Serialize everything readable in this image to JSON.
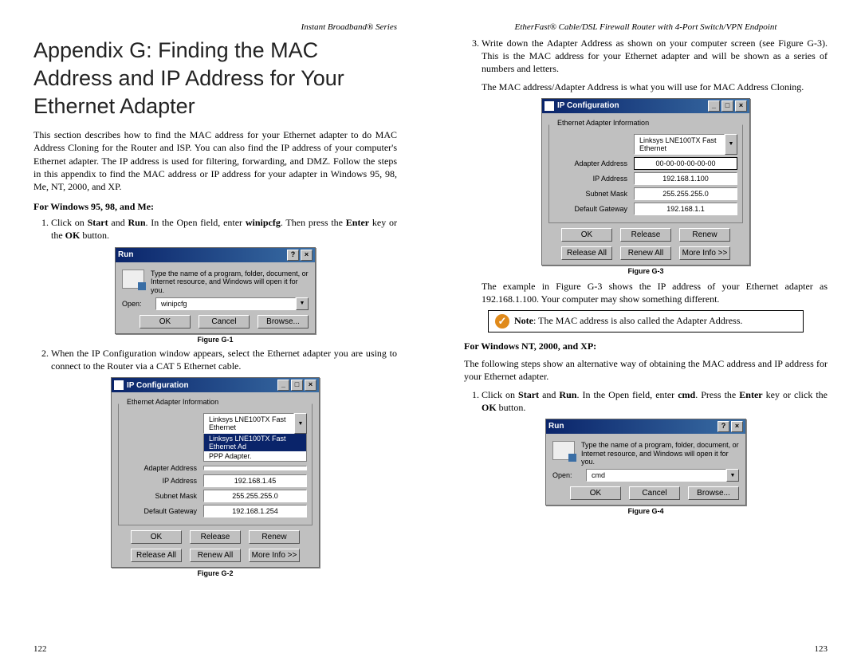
{
  "left": {
    "running_head": "Instant Broadband® Series",
    "title": "Appendix G: Finding the MAC Address and IP Address for Your Ethernet Adapter",
    "intro": "This section describes how to find the MAC address for your Ethernet adapter to do MAC Address Cloning for the Router and ISP. You can also find the IP address of your computer's Ethernet adapter. The IP address is used for filtering, forwarding, and DMZ. Follow the steps in this appendix to find the MAC address or IP address for your adapter in Windows 95, 98, Me, NT, 2000, and XP.",
    "subhead1": "For Windows 95, 98, and Me:",
    "step1_pre": "Click on ",
    "step1_b1": "Start",
    "step1_mid1": " and ",
    "step1_b2": "Run",
    "step1_mid2": ". In the Open field, enter ",
    "step1_b3": "winipcfg",
    "step1_mid3": ". Then press the ",
    "step1_b4": "Enter",
    "step1_mid4": " key or the ",
    "step1_b5": "OK",
    "step1_end": " button.",
    "figcap1": "Figure G-1",
    "step2": "When the IP Configuration window appears, select the Ethernet adapter you are using to connect to the Router via a CAT 5 Ethernet cable.",
    "figcap2": "Figure G-2",
    "pagenum": "122",
    "run_dialog": {
      "title": "Run",
      "hint": "Type the name of a program, folder, document, or Internet resource, and Windows will open it for you.",
      "open_label": "Open:",
      "open_value": "winipcfg",
      "ok": "OK",
      "cancel": "Cancel",
      "browse": "Browse..."
    },
    "ipcfg": {
      "title": "IP Configuration",
      "group": "Ethernet Adapter Information",
      "combo": "Linksys LNE100TX Fast Ethernet",
      "combo_sel": "Linksys LNE100TX Fast Ethernet Ad",
      "combo_opt2": "PPP Adapter.",
      "lab_adapter": "Adapter Address",
      "val_adapter": "",
      "lab_ip": "IP Address",
      "val_ip": "192.168.1.45",
      "lab_mask": "Subnet Mask",
      "val_mask": "255.255.255.0",
      "lab_gw": "Default Gateway",
      "val_gw": "192.168.1.254",
      "ok": "OK",
      "release": "Release",
      "renew": "Renew",
      "release_all": "Release All",
      "renew_all": "Renew All",
      "more": "More Info >>"
    }
  },
  "right": {
    "running_head": "EtherFast® Cable/DSL Firewall Router with 4-Port Switch/VPN Endpoint",
    "step3": "Write down the Adapter Address as shown on your computer screen (see Figure G-3). This is the MAC address for your Ethernet adapter and will be shown as a series of numbers and letters.",
    "clone": "The MAC address/Adapter Address is what you will use for MAC Address Cloning.",
    "figcap3": "Figure G-3",
    "example": "The example in Figure G-3 shows the IP address of your Ethernet adapter as 192.168.1.100. Your computer may show something different.",
    "note_b": "Note",
    "note_rest": ": The MAC address is also called the Adapter Address.",
    "subhead2": "For Windows NT, 2000, and XP:",
    "altsteps": "The following steps show an alternative way of obtaining the MAC address and IP address for your Ethernet adapter.",
    "step1r_pre": "Click on ",
    "step1r_b1": "Start",
    "step1r_mid1": " and ",
    "step1r_b2": "Run",
    "step1r_mid2": ". In the Open field, enter ",
    "step1r_b3": "cmd",
    "step1r_mid3": ". Press the ",
    "step1r_b4": "Enter",
    "step1r_mid4": " key or click the ",
    "step1r_b5": "OK",
    "step1r_end": " button.",
    "figcap4": "Figure G-4",
    "pagenum": "123",
    "ipcfg": {
      "title": "IP Configuration",
      "group": "Ethernet Adapter Information",
      "combo": "Linksys LNE100TX Fast Ethernet",
      "lab_adapter": "Adapter Address",
      "val_adapter": "00-00-00-00-00-00",
      "lab_ip": "IP Address",
      "val_ip": "192.168.1.100",
      "lab_mask": "Subnet Mask",
      "val_mask": "255.255.255.0",
      "lab_gw": "Default Gateway",
      "val_gw": "192.168.1.1",
      "ok": "OK",
      "release": "Release",
      "renew": "Renew",
      "release_all": "Release All",
      "renew_all": "Renew All",
      "more": "More Info >>"
    },
    "run_dialog": {
      "title": "Run",
      "hint": "Type the name of a program, folder, document, or Internet resource, and Windows will open it for you.",
      "open_label": "Open:",
      "open_value": "cmd",
      "ok": "OK",
      "cancel": "Cancel",
      "browse": "Browse..."
    }
  }
}
